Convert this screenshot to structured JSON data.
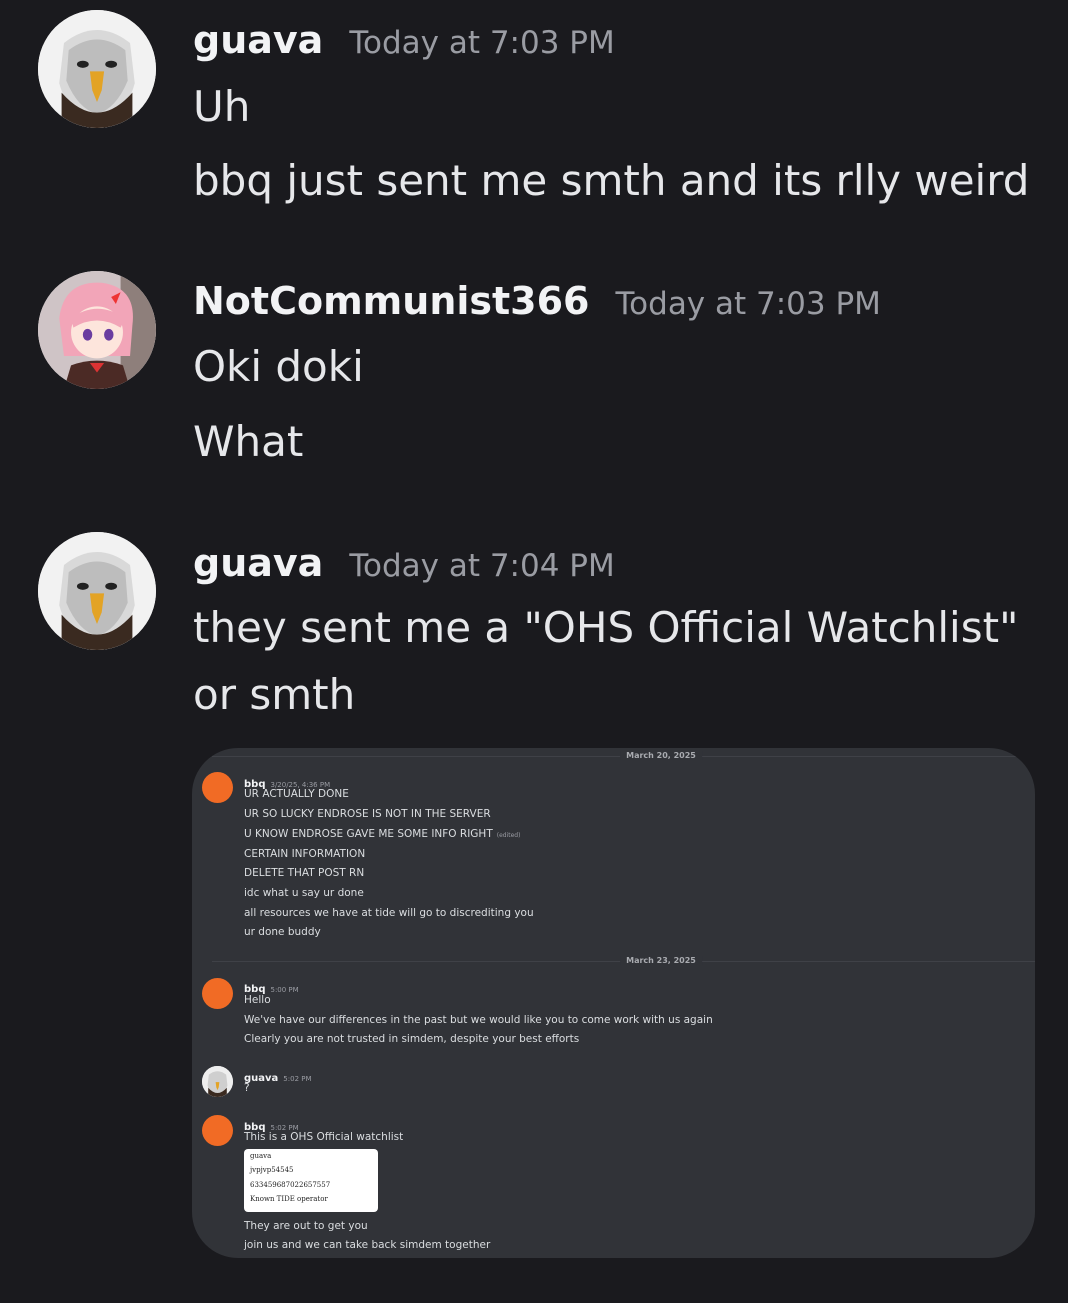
{
  "messages": [
    {
      "username": "guava",
      "timestamp": "Today at 7:03 PM",
      "lines": [
        "Uh",
        "bbq just sent me smth and its rlly weird"
      ]
    },
    {
      "username": "NotCommunist366",
      "timestamp": "Today at 7:03 PM",
      "lines": [
        "Oki doki",
        "What"
      ]
    },
    {
      "username": "guava",
      "timestamp": "Today at 7:04 PM",
      "lines": [
        "they sent me a \"OHS Official Watchlist\"",
        "or smth"
      ]
    }
  ],
  "embed": {
    "dividers": [
      "March 20, 2025",
      "March 23, 2025"
    ],
    "messages": [
      {
        "username": "bbq",
        "timestamp": "3/20/25, 4:36 PM",
        "lines": [
          "UR ACTUALLY DONE",
          "UR SO LUCKY ENDROSE IS NOT IN THE SERVER",
          "U KNOW ENDROSE GAVE ME SOME INFO RIGHT",
          "CERTAIN INFORMATION",
          "DELETE THAT POST RN",
          "idc what u say ur done",
          "all resources we have at tide will go to discrediting you",
          "ur done buddy"
        ],
        "edited_label": "(edited)"
      },
      {
        "username": "bbq",
        "timestamp": "5:00 PM",
        "lines": [
          "Hello",
          "We've have our differences in the past but we would like you to come work with us again",
          "Clearly you are not trusted in simdem, despite your best efforts"
        ]
      },
      {
        "username": "guava",
        "timestamp": "5:02 PM",
        "lines": [
          "?"
        ]
      },
      {
        "username": "bbq",
        "timestamp": "5:02 PM",
        "lines": [
          "This is a OHS Official watchlist"
        ],
        "watchlist_card": [
          "guava",
          "jvpjvp54545",
          "633459687022657557",
          "Known TIDE operator"
        ],
        "after_lines": [
          "They are out to get you",
          "join us and we can take back simdem together"
        ]
      }
    ]
  },
  "colors": {
    "background": "#1a1a1e",
    "embed_background": "#313338",
    "bbq_avatar": "#f16b25"
  },
  "icons": [
    "eagle-avatar-icon",
    "anime-girl-avatar-icon",
    "orange-circle-avatar-icon"
  ]
}
